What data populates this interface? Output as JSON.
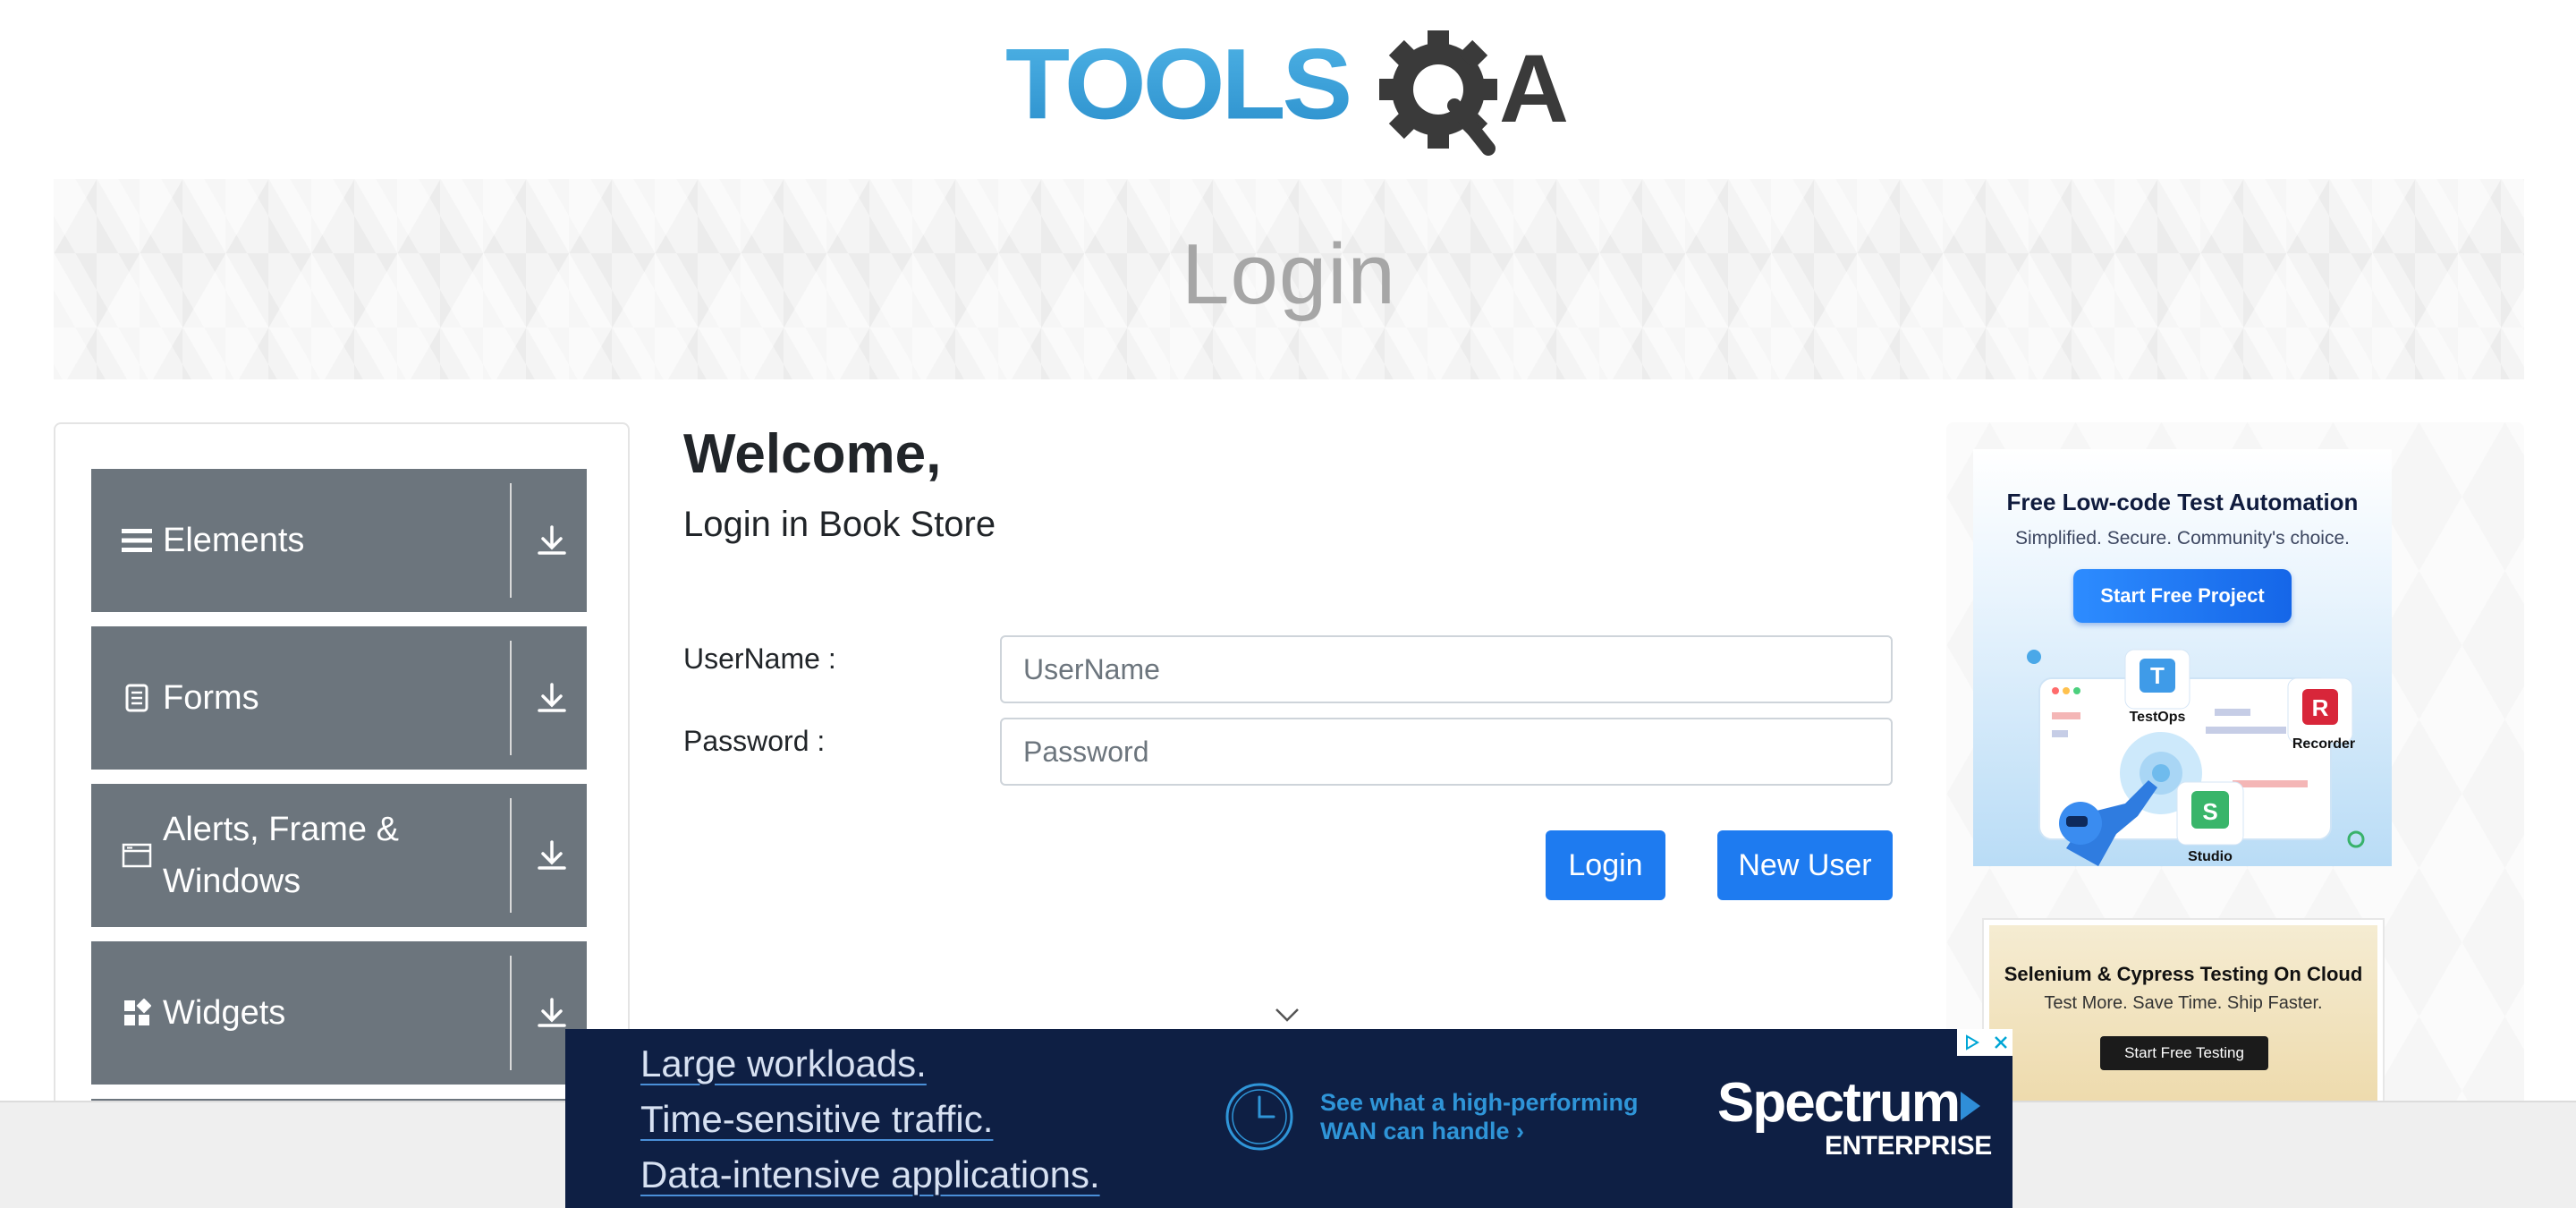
{
  "header": {
    "logo_text": "TOOLSQA",
    "banner_title": "Login"
  },
  "sidebar": {
    "items": [
      {
        "label": "Elements",
        "icon": "hamburger-icon"
      },
      {
        "label": "Forms",
        "icon": "document-icon"
      },
      {
        "label": "Alerts, Frame & Windows",
        "icon": "window-icon"
      },
      {
        "label": "Widgets",
        "icon": "widgets-icon"
      }
    ]
  },
  "main": {
    "welcome": "Welcome,",
    "subtitle": "Login in Book Store",
    "username_label": "UserName :",
    "username_placeholder": "UserName",
    "username_value": "",
    "password_label": "Password :",
    "password_placeholder": "Password",
    "password_value": "",
    "login_button": "Login",
    "new_user_button": "New User"
  },
  "ads": {
    "katalon": {
      "title": "Free Low-code Test Automation",
      "subtitle": "Simplified. Secure. Community's choice.",
      "button": "Start Free Project",
      "products": [
        "TestOps",
        "Recorder",
        "Studio"
      ]
    },
    "cloud": {
      "title": "Selenium & Cypress Testing On Cloud",
      "subtitle": "Test More. Save Time. Ship Faster.",
      "button": "Start Free Testing"
    },
    "bottom": {
      "lines": [
        "Large workloads.",
        "Time-sensitive traffic.",
        "Data-intensive applications."
      ],
      "cta_line1": "See what a high-performing",
      "cta_line2": "WAN can handle ›",
      "brand": "Spectrum",
      "brand_sub": "ENTERPRISE"
    }
  },
  "colors": {
    "menu_bg": "#6c757d",
    "primary_button": "#1e7bf0",
    "logo_blue": "#3da2db",
    "logo_dark": "#3a3a3a",
    "bottom_ad_bg": "#0e1f44"
  }
}
